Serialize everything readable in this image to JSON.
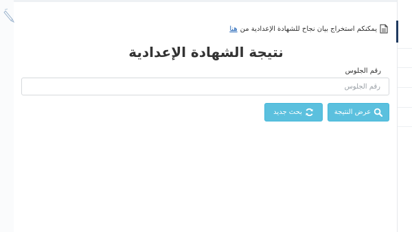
{
  "info": {
    "text": "يمكنكم استخراج بيان نجاح للشهادة الإعدادية من",
    "link": "هنا",
    "icon": "document-icon"
  },
  "page": {
    "title": "نتيجة الشهادة الإعدادية"
  },
  "form": {
    "seat_label": "رقم الجلوس",
    "seat_placeholder": "رقم الجلوس",
    "seat_value": ""
  },
  "buttons": {
    "show_result": {
      "label": "عرض النتيجة",
      "icon": "search-icon"
    },
    "new_search": {
      "label": "بحث جديد",
      "icon": "refresh-icon"
    }
  },
  "colors": {
    "button": "#5bc0de",
    "link": "#1a5fb4",
    "accent": "#1f3a5f"
  }
}
